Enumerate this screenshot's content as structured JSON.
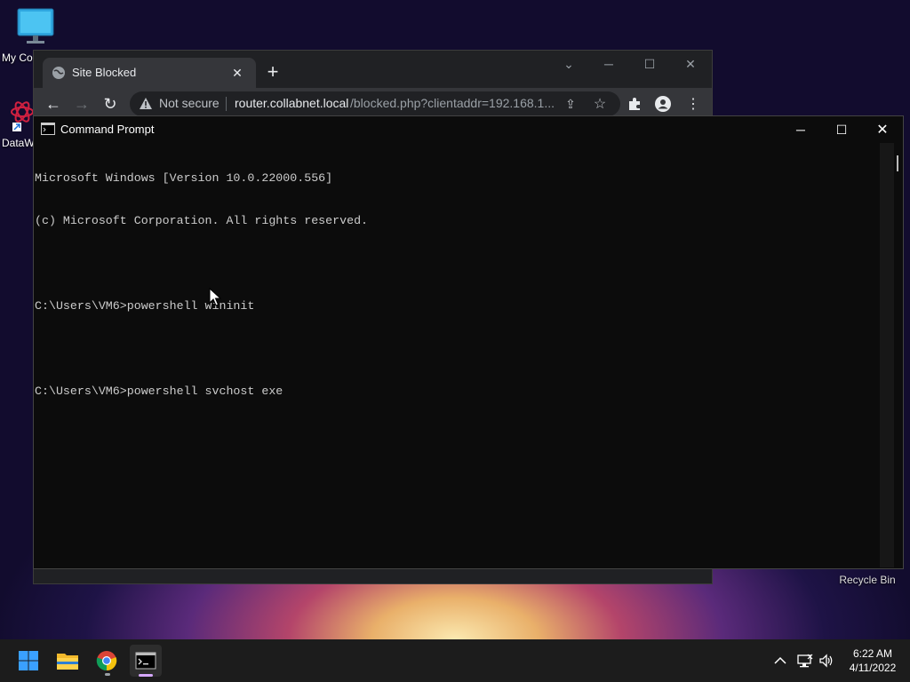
{
  "desktop": {
    "icons": [
      {
        "label": "My Co"
      },
      {
        "label": "DataW"
      },
      {
        "label": "Recycle Bin"
      }
    ]
  },
  "browser": {
    "tab_title": "Site Blocked",
    "security_label": "Not secure",
    "url_host": "router.collabnet.local",
    "url_path": "/blocked.php?clientaddr=192.168.1..."
  },
  "cmd": {
    "title": "Command Prompt",
    "lines": [
      "Microsoft Windows [Version 10.0.22000.556]",
      "(c) Microsoft Corporation. All rights reserved.",
      "",
      "C:\\Users\\VM6>powershell wininit",
      "",
      "C:\\Users\\VM6>powershell svchost exe"
    ]
  },
  "taskbar": {
    "time": "6:22 AM",
    "date": "4/11/2022"
  },
  "colors": {
    "chrome_bg": "#202124",
    "chrome_toolbar": "#35363a",
    "console_bg": "#0c0c0c",
    "console_text": "#cccccc",
    "taskbar_bg": "#1c1c1c"
  }
}
